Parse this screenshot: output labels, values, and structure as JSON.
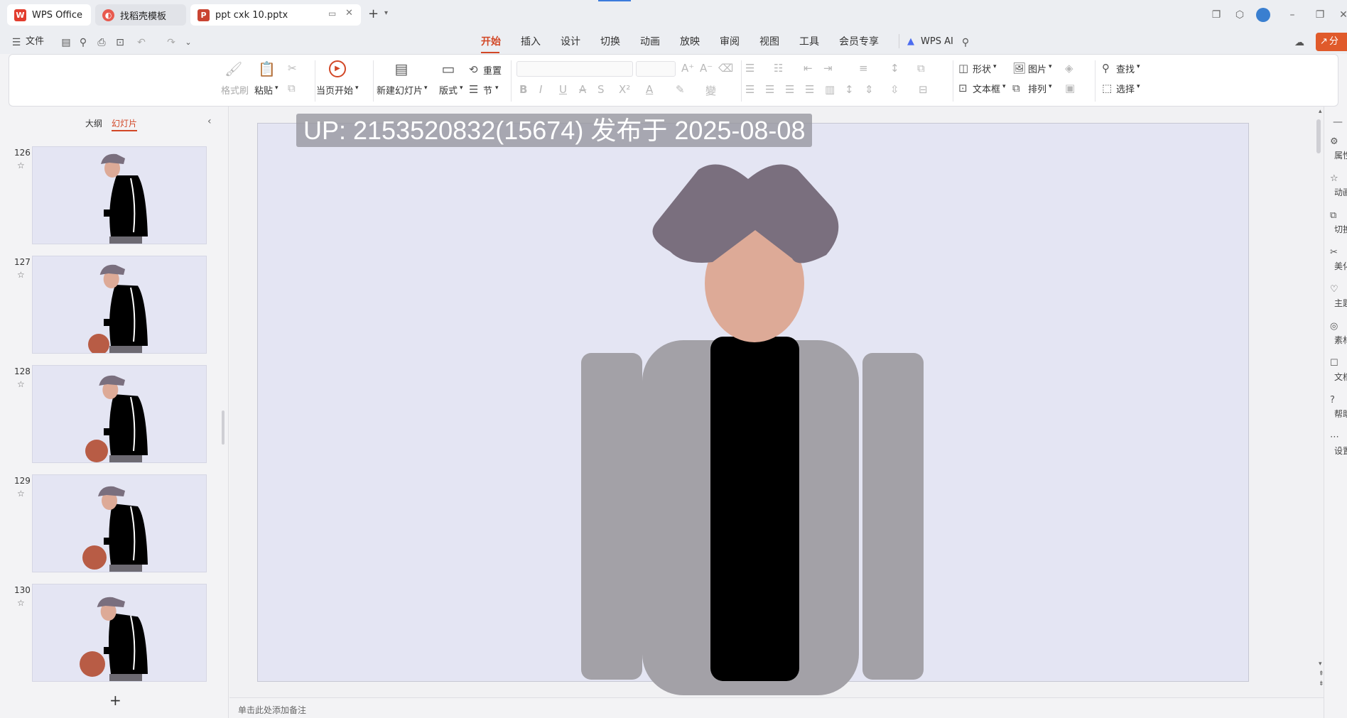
{
  "tabs": [
    {
      "label": "WPS Office",
      "icon": "wps-logo-icon"
    },
    {
      "label": "找稻壳模板",
      "icon": "docer-icon"
    },
    {
      "label": "ppt cxk 10.pptx",
      "icon": "ppt-file-icon"
    }
  ],
  "menu": {
    "file": "文件",
    "items": [
      "开始",
      "插入",
      "设计",
      "切换",
      "动画",
      "放映",
      "审阅",
      "视图",
      "工具",
      "会员专享"
    ],
    "active": "开始",
    "ai": "WPS AI",
    "share": "分享"
  },
  "ribbon": {
    "format_painter": "格式刷",
    "paste": "粘贴",
    "play_from_current": "当页开始",
    "new_slide": "新建幻灯片",
    "layout": "版式",
    "reset": "重置",
    "section": "节",
    "shape": "形状",
    "picture": "图片",
    "find": "查找",
    "textbox": "文本框",
    "arrange": "排列",
    "select": "选择"
  },
  "panel": {
    "outline_tab": "大纲",
    "slides_tab": "幻灯片",
    "active_tab": "幻灯片",
    "add": "+"
  },
  "slides": [
    {
      "number": "126",
      "ball": false
    },
    {
      "number": "127",
      "ball": true
    },
    {
      "number": "128",
      "ball": true
    },
    {
      "number": "129",
      "ball": true
    },
    {
      "number": "130",
      "ball": true
    }
  ],
  "watermark": "UP: 2153520832(15674) 发布于 2025-08-08",
  "notes_placeholder": "单击此处添加备注",
  "right_sidebar": [
    "属性",
    "动画",
    "切换",
    "美化",
    "主题",
    "素材",
    "文档",
    "帮助",
    "设置"
  ],
  "colors": {
    "accent": "#d24726",
    "ppt_red": "#c94432",
    "slide_bg": "#e4e5f3",
    "hair": "#7a6f7e",
    "skin": "#ddaa97",
    "jacket": "#a3a1a7",
    "shirt": "#000000",
    "ball": "#b85c45"
  }
}
